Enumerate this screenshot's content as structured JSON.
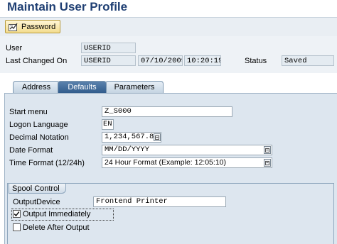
{
  "page": {
    "title": "Maintain User Profile"
  },
  "toolbar": {
    "password_label": "Password"
  },
  "header": {
    "user_label": "User",
    "user_value": "USERID",
    "last_changed_label": "Last Changed On",
    "last_changed_by": "USERID",
    "last_changed_date": "07/10/2009",
    "last_changed_time": "10:20:19",
    "status_label": "Status",
    "status_value": "Saved"
  },
  "tabs": [
    {
      "label": "Address",
      "active": false
    },
    {
      "label": "Defaults",
      "active": true
    },
    {
      "label": "Parameters",
      "active": false
    }
  ],
  "defaults": {
    "start_menu_label": "Start menu",
    "start_menu_value": "Z_S000",
    "logon_language_label": "Logon Language",
    "logon_language_value": "EN",
    "decimal_notation_label": "Decimal Notation",
    "decimal_notation_value": "1,234,567.89",
    "date_format_label": "Date Format",
    "date_format_value": "MM/DD/YYYY",
    "time_format_label": "Time Format (12/24h)",
    "time_format_value": "24 Hour Format (Example: 12:05:10)"
  },
  "spool": {
    "group_title": "Spool Control",
    "output_device_label": "OutputDevice",
    "output_device_value": "Frontend Printer",
    "output_immediately_label": "Output Immediately",
    "output_immediately_checked": true,
    "delete_after_output_label": "Delete After Output",
    "delete_after_output_checked": false
  }
}
